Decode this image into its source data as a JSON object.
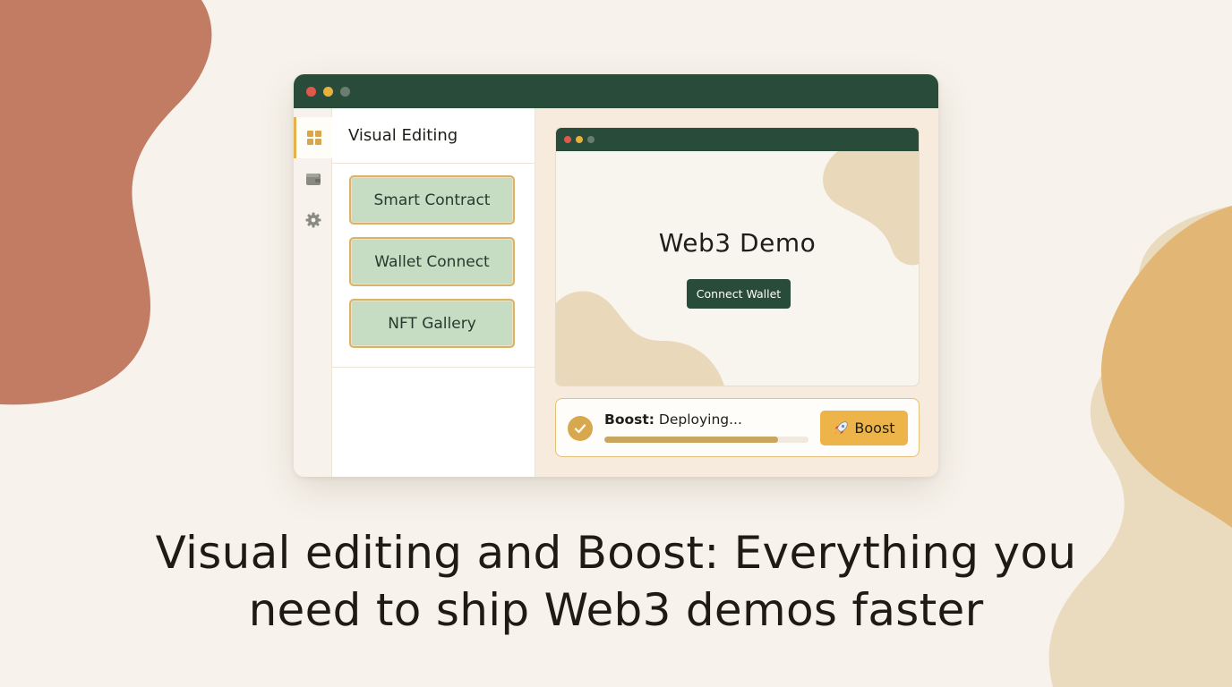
{
  "colors": {
    "background": "#f7f3ec",
    "brand_green": "#294c3a",
    "accent_gold": "#edb44a",
    "blob_terracotta": "#c27c64",
    "component_green": "#c6dcc3"
  },
  "sidebar": {
    "icons": [
      {
        "name": "components-grid-icon",
        "active": true
      },
      {
        "name": "wallet-icon",
        "active": false
      },
      {
        "name": "gear-icon",
        "active": false
      }
    ]
  },
  "panel": {
    "title": "Visual Editing",
    "components": [
      "Smart Contract",
      "Wallet Connect",
      "NFT Gallery"
    ]
  },
  "preview": {
    "title": "Web3 Demo",
    "cta_label": "Connect Wallet"
  },
  "boost": {
    "status_label": "Boost:",
    "status_value": "Deploying...",
    "progress": 0.85,
    "button_icon": "rocket-icon",
    "button_label": "Boost"
  },
  "headline": {
    "line1": "Visual editing and Boost: Everything you",
    "line2": "need to ship Web3 demos faster"
  }
}
